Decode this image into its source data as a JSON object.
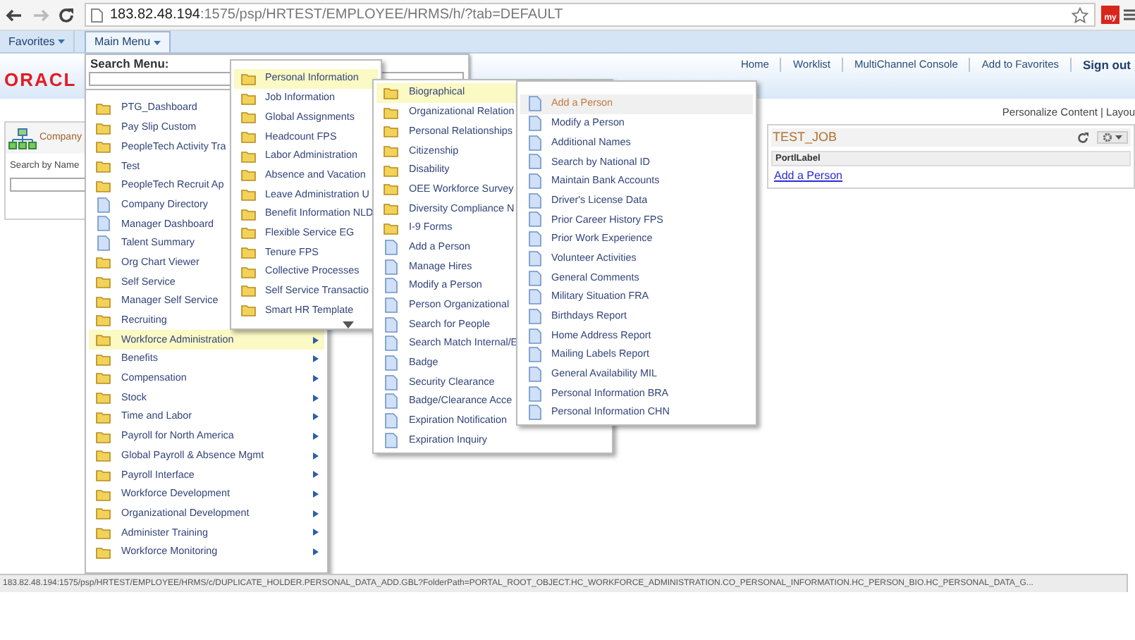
{
  "browser": {
    "url_host": "183.82.48.194",
    "url_rest": ":1575/psp/HRTEST/EMPLOYEE/HRMS/h/?tab=DEFAULT",
    "extension_label": "my"
  },
  "menubar": [
    {
      "label": "Favorites",
      "selected": false
    },
    {
      "label": "Main Menu",
      "selected": true
    }
  ],
  "logo": "ORACL",
  "header_links": [
    {
      "label": "Home",
      "kind": "link"
    },
    {
      "label": "Worklist",
      "kind": "link"
    },
    {
      "label": "MultiChannel Console",
      "kind": "link"
    },
    {
      "label": "Add to Favorites",
      "kind": "link"
    },
    {
      "label": "Sign out",
      "kind": "strong"
    }
  ],
  "personalize": "Personalize Content | Layou",
  "left_pagelet": {
    "title": "Company",
    "search_label": "Search by Name"
  },
  "search_menu": {
    "label": "Search Menu:"
  },
  "menus": [
    {
      "items": [
        {
          "label": "PTG_Dashboard",
          "kind": "folder",
          "selected": false
        },
        {
          "label": "Pay Slip Custom",
          "kind": "folder",
          "selected": false
        },
        {
          "label": "PeopleTech Activity Tra",
          "kind": "folder",
          "selected": false
        },
        {
          "label": "Test",
          "kind": "folder",
          "selected": false
        },
        {
          "label": "PeopleTech Recruit Ap",
          "kind": "folder",
          "selected": false
        },
        {
          "label": "Company Directory",
          "kind": "page",
          "selected": false
        },
        {
          "label": "Manager Dashboard",
          "kind": "page",
          "selected": false
        },
        {
          "label": "Talent Summary",
          "kind": "page",
          "selected": false
        },
        {
          "label": "Org Chart Viewer",
          "kind": "folder",
          "selected": false
        },
        {
          "label": "Self Service",
          "kind": "folder",
          "selected": false
        },
        {
          "label": "Manager Self Service",
          "kind": "folder",
          "selected": false
        },
        {
          "label": "Recruiting",
          "kind": "folder",
          "selected": false
        },
        {
          "label": "Workforce Administration",
          "kind": "folder",
          "selected": true
        },
        {
          "label": "Benefits",
          "kind": "folder",
          "selected": false
        },
        {
          "label": "Compensation",
          "kind": "folder",
          "selected": false
        },
        {
          "label": "Stock",
          "kind": "folder",
          "selected": false
        },
        {
          "label": "Time and Labor",
          "kind": "folder",
          "selected": false
        },
        {
          "label": "Payroll for North America",
          "kind": "folder",
          "selected": false
        },
        {
          "label": "Global Payroll & Absence Mgmt",
          "kind": "folder",
          "selected": false
        },
        {
          "label": "Payroll Interface",
          "kind": "folder",
          "selected": false
        },
        {
          "label": "Workforce Development",
          "kind": "folder",
          "selected": false
        },
        {
          "label": "Organizational Development",
          "kind": "folder",
          "selected": false
        },
        {
          "label": "Administer Training",
          "kind": "folder",
          "selected": false
        },
        {
          "label": "Workforce Monitoring",
          "kind": "folder",
          "selected": false
        }
      ]
    },
    {
      "items": [
        {
          "label": "Personal Information",
          "kind": "folder",
          "selected": true
        },
        {
          "label": "Job Information",
          "kind": "folder",
          "selected": false
        },
        {
          "label": "Global Assignments",
          "kind": "folder",
          "selected": false
        },
        {
          "label": "Headcount FPS",
          "kind": "folder",
          "selected": false
        },
        {
          "label": "Labor Administration",
          "kind": "folder",
          "selected": false
        },
        {
          "label": "Absence and Vacation",
          "kind": "folder",
          "selected": false
        },
        {
          "label": "Leave Administration U",
          "kind": "folder",
          "selected": false
        },
        {
          "label": "Benefit Information NLD",
          "kind": "folder",
          "selected": false
        },
        {
          "label": "Flexible Service EG",
          "kind": "folder",
          "selected": false
        },
        {
          "label": "Tenure FPS",
          "kind": "folder",
          "selected": false
        },
        {
          "label": "Collective Processes",
          "kind": "folder",
          "selected": false
        },
        {
          "label": "Self Service Transactio",
          "kind": "folder",
          "selected": false
        },
        {
          "label": "Smart HR Template",
          "kind": "folder",
          "selected": false
        }
      ]
    },
    {
      "items": [
        {
          "label": "Biographical",
          "kind": "folder",
          "selected": true
        },
        {
          "label": "Organizational Relation",
          "kind": "folder",
          "selected": false
        },
        {
          "label": "Personal Relationships",
          "kind": "folder",
          "selected": false
        },
        {
          "label": "Citizenship",
          "kind": "folder",
          "selected": false
        },
        {
          "label": "Disability",
          "kind": "folder",
          "selected": false
        },
        {
          "label": "OEE Workforce Survey",
          "kind": "folder",
          "selected": false
        },
        {
          "label": "Diversity Compliance N",
          "kind": "folder",
          "selected": false
        },
        {
          "label": "I-9 Forms",
          "kind": "folder",
          "selected": false
        },
        {
          "label": "Add a Person",
          "kind": "page",
          "selected": false
        },
        {
          "label": "Manage Hires",
          "kind": "page",
          "selected": false
        },
        {
          "label": "Modify a Person",
          "kind": "page",
          "selected": false
        },
        {
          "label": "Person Organizational",
          "kind": "page",
          "selected": false
        },
        {
          "label": "Search for People",
          "kind": "page",
          "selected": false
        },
        {
          "label": "Search Match Internal/E",
          "kind": "page",
          "selected": false
        },
        {
          "label": "Badge",
          "kind": "page",
          "selected": false
        },
        {
          "label": "Security Clearance",
          "kind": "page",
          "selected": false
        },
        {
          "label": "Badge/Clearance Acce",
          "kind": "page",
          "selected": false
        },
        {
          "label": "Expiration Notification",
          "kind": "page",
          "selected": false
        },
        {
          "label": "Expiration Inquiry",
          "kind": "page",
          "selected": false
        }
      ]
    },
    {
      "items": [
        {
          "label": "Add a Person",
          "kind": "page",
          "hovered": true
        },
        {
          "label": "Modify a Person",
          "kind": "page",
          "hovered": false
        },
        {
          "label": "Additional Names",
          "kind": "page",
          "hovered": false
        },
        {
          "label": "Search by National ID",
          "kind": "page",
          "hovered": false
        },
        {
          "label": "Maintain Bank Accounts",
          "kind": "page",
          "hovered": false
        },
        {
          "label": "Driver's License Data",
          "kind": "page",
          "hovered": false
        },
        {
          "label": "Prior Career History FPS",
          "kind": "page",
          "hovered": false
        },
        {
          "label": "Prior Work Experience",
          "kind": "page",
          "hovered": false
        },
        {
          "label": "Volunteer Activities",
          "kind": "page",
          "hovered": false
        },
        {
          "label": "General Comments",
          "kind": "page",
          "hovered": false
        },
        {
          "label": "Military Situation FRA",
          "kind": "page",
          "hovered": false
        },
        {
          "label": "Birthdays Report",
          "kind": "page",
          "hovered": false
        },
        {
          "label": "Home Address Report",
          "kind": "page",
          "hovered": false
        },
        {
          "label": "Mailing Labels Report",
          "kind": "page",
          "hovered": false
        },
        {
          "label": "General Availability MIL",
          "kind": "page",
          "hovered": false
        },
        {
          "label": "Personal Information BRA",
          "kind": "page",
          "hovered": false
        },
        {
          "label": "Personal Information CHN",
          "kind": "page",
          "hovered": false
        }
      ]
    }
  ],
  "pagelet": {
    "title": "TEST_JOB",
    "column": "PortlLabel",
    "link": "Add a Person"
  },
  "status_bar": "183.82.48.194:1575/psp/HRTEST/EMPLOYEE/HRMS/c/DUPLICATE_HOLDER.PERSONAL_DATA_ADD.GBL?FolderPath=PORTAL_ROOT_OBJECT.HC_WORKFORCE_ADMINISTRATION.CO_PERSONAL_INFORMATION.HC_PERSON_BIO.HC_PERSONAL_DATA_G..."
}
